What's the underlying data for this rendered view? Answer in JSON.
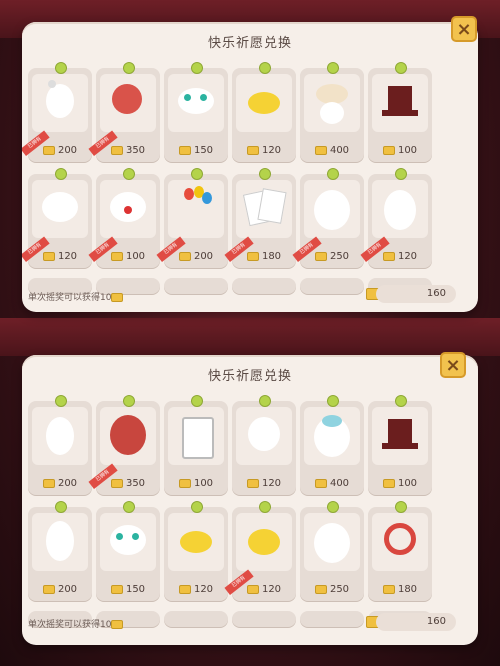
{
  "panels": [
    {
      "title": "快乐祈愿兑换",
      "close_icon": "×",
      "footer_text": "单次摇奖可以获得10",
      "total": "160",
      "items": [
        {
          "name": "bear-hat",
          "price": "200"
        },
        {
          "name": "red-mushroom-hat",
          "price": "350"
        },
        {
          "name": "face-mask",
          "price": "150"
        },
        {
          "name": "yellow-smile",
          "price": "120"
        },
        {
          "name": "flower-crown",
          "price": "400"
        },
        {
          "name": "top-hat",
          "price": "100"
        },
        {
          "name": "white-mask",
          "price": "120"
        },
        {
          "name": "clown-face",
          "price": "100"
        },
        {
          "name": "balloons",
          "price": "200"
        },
        {
          "name": "playing-cards",
          "price": "180"
        },
        {
          "name": "white-gown",
          "price": "250"
        },
        {
          "name": "white-suit",
          "price": "120"
        }
      ]
    },
    {
      "title": "快乐祈愿兑换",
      "close_icon": "×",
      "footer_text": "单次摇奖可以获得10",
      "total": "160",
      "items": [
        {
          "name": "bunny-doll",
          "price": "200"
        },
        {
          "name": "red-hood",
          "price": "350"
        },
        {
          "name": "card-frame",
          "price": "100"
        },
        {
          "name": "white-cap",
          "price": "120"
        },
        {
          "name": "tutu-dress",
          "price": "400"
        },
        {
          "name": "top-hat",
          "price": "100"
        },
        {
          "name": "rabbit-plush",
          "price": "200"
        },
        {
          "name": "eyed-mask",
          "price": "150"
        },
        {
          "name": "yellow-face",
          "price": "120"
        },
        {
          "name": "smile-face",
          "price": "120"
        },
        {
          "name": "white-dress",
          "price": "250"
        },
        {
          "name": "red-ring",
          "price": "180"
        }
      ]
    }
  ],
  "badge_text": "已拥有",
  "colors": {
    "panel": "#f6efe9",
    "card": "#e6dcd5",
    "accent_green": "#b4d34a",
    "coin": "#f0c040",
    "close": "#f2c24e"
  }
}
